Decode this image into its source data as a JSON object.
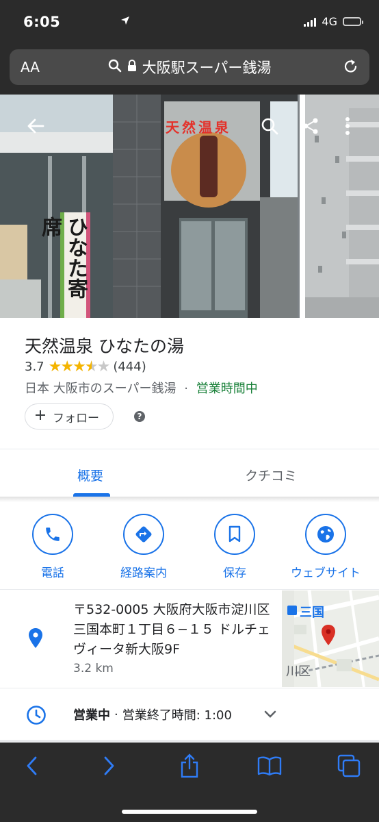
{
  "status_bar": {
    "time": "6:05",
    "network": "4G"
  },
  "browser": {
    "text_size_label": "AA",
    "url_text": "大阪駅スーパー銭湯"
  },
  "photo": {
    "signboard_text": "天然温泉",
    "banner_text": "ひなた寄席"
  },
  "place": {
    "name": "天然温泉 ひなたの湯",
    "rating": "3.7",
    "rating_value": 3.7,
    "review_count": "(444)",
    "category": "日本 大阪市のスーパー銭湯",
    "separator": "·",
    "open_status": "営業時間中",
    "follow_label": "フォロー",
    "help_label": "?"
  },
  "tabs": [
    {
      "label": "概要",
      "active": true
    },
    {
      "label": "クチコミ",
      "active": false
    }
  ],
  "actions": [
    {
      "label": "電話",
      "icon": "phone-icon"
    },
    {
      "label": "経路案内",
      "icon": "directions-icon"
    },
    {
      "label": "保存",
      "icon": "bookmark-icon"
    },
    {
      "label": "ウェブサイト",
      "icon": "globe-icon"
    }
  ],
  "address": {
    "text": "〒532-0005 大阪府大阪市淀川区三国本町１丁目６−１５ ドルチェヴィータ新大阪9F",
    "distance": "3.2 km",
    "map_station_label": "三国",
    "map_area_label": "川区"
  },
  "hours": {
    "status": "営業中",
    "separator": "·",
    "closing": "営業終了時間: 1:00"
  },
  "colors": {
    "accent": "#1a73e8",
    "open_green": "#188038",
    "star": "#f4b400",
    "map_pin": "#d93025",
    "chrome_dark": "#2b2b2b"
  }
}
